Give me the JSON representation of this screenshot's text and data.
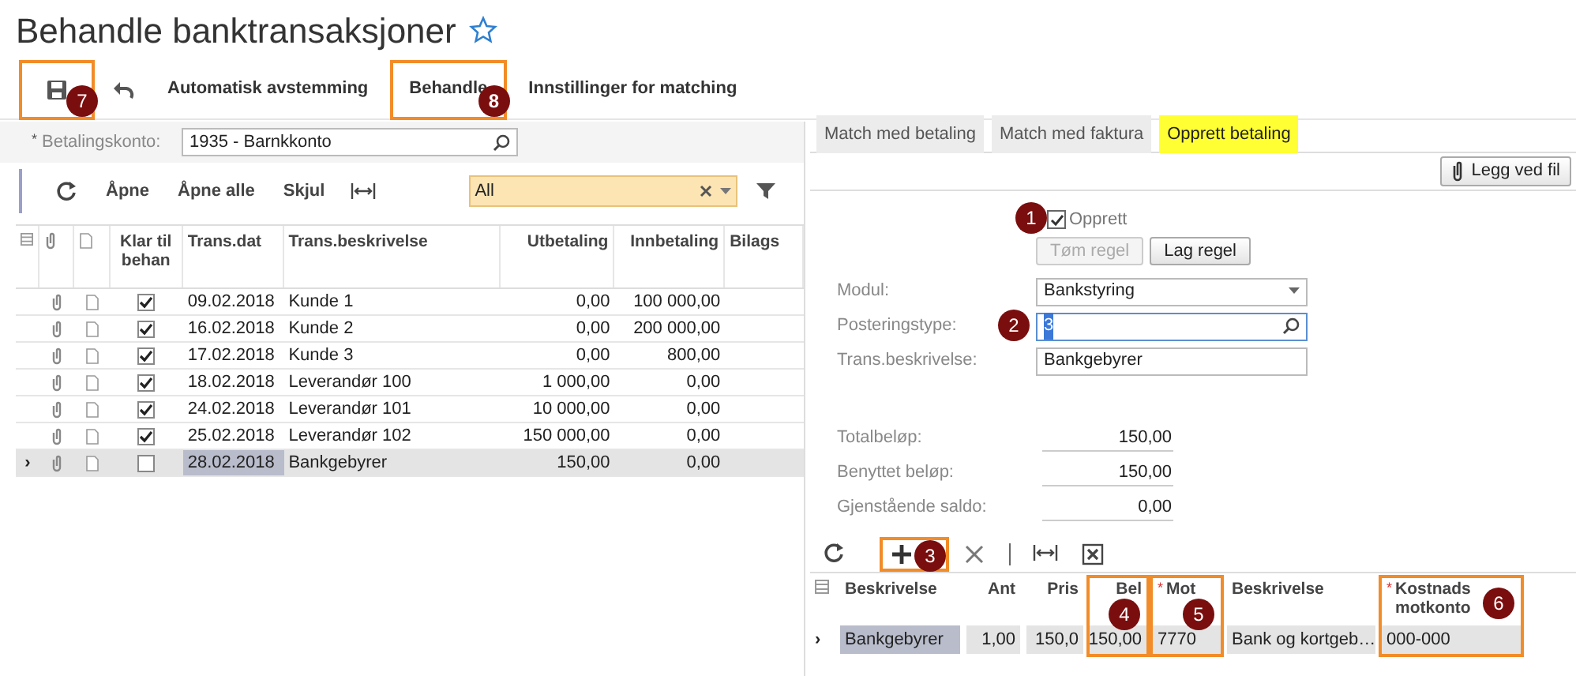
{
  "page": {
    "title": "Behandle banktransaksjoner",
    "favorite": false
  },
  "toolbar": [
    {
      "kind": "save",
      "callout": "7"
    },
    {
      "kind": "undo"
    },
    {
      "kind": "text",
      "label": "Automatisk avstemming"
    },
    {
      "kind": "text",
      "label": "Behandle",
      "callout": "8"
    },
    {
      "kind": "text",
      "label": "Innstillinger for matching"
    }
  ],
  "account": {
    "mark": "*",
    "label": "Betalingskonto:",
    "value": "1935 - Barnkkonto"
  },
  "grid_toolbar": [
    {
      "kind": "refresh"
    },
    {
      "kind": "text",
      "label": "Åpne"
    },
    {
      "kind": "text",
      "label": "Åpne alle"
    },
    {
      "kind": "text",
      "label": "Skjul"
    },
    {
      "kind": "fit"
    }
  ],
  "filter": {
    "value": "All"
  },
  "transactions": {
    "columns": [
      "Klar til behan",
      "Trans.dat",
      "Trans.beskrivelse",
      "Utbetaling",
      "Innbetaling",
      "Bilags"
    ],
    "rows": [
      {
        "checked": true,
        "selected": false,
        "date": "09.02.2018",
        "description": "Kunde 1",
        "out": "0,00",
        "in": "100 000,00"
      },
      {
        "checked": true,
        "selected": false,
        "date": "16.02.2018",
        "description": "Kunde 2",
        "out": "0,00",
        "in": "200 000,00"
      },
      {
        "checked": true,
        "selected": false,
        "date": "17.02.2018",
        "description": "Kunde 3",
        "out": "0,00",
        "in": "800,00"
      },
      {
        "checked": true,
        "selected": false,
        "date": "18.02.2018",
        "description": "Leverandør 100",
        "out": "1 000,00",
        "in": "0,00"
      },
      {
        "checked": true,
        "selected": false,
        "date": "24.02.2018",
        "description": "Leverandør 101",
        "out": "10 000,00",
        "in": "0,00"
      },
      {
        "checked": true,
        "selected": false,
        "date": "25.02.2018",
        "description": "Leverandør 102",
        "out": "150 000,00",
        "in": "0,00"
      },
      {
        "checked": false,
        "selected": true,
        "indicator": "›",
        "date": "28.02.2018",
        "description": "Bankgebyrer",
        "out": "150,00",
        "in": "0,00"
      }
    ]
  },
  "tabs": [
    {
      "label": "Match med betaling",
      "selected": false
    },
    {
      "label": "Match med faktura",
      "selected": false
    },
    {
      "label": "Opprett betaling",
      "selected": true
    }
  ],
  "attach_button": {
    "label": "Legg ved fil"
  },
  "create": {
    "label": "Opprett",
    "checked": true,
    "callout": "1"
  },
  "rule_buttons": [
    {
      "label": "Tøm regel",
      "disabled": true
    },
    {
      "label": "Lag regel",
      "disabled": false
    }
  ],
  "form": [
    {
      "kind": "dropdown",
      "label": "Modul:",
      "value": "Bankstyring"
    },
    {
      "kind": "lookup",
      "label": "Posteringstype:",
      "value": "3",
      "callout": "2"
    },
    {
      "kind": "text",
      "label": "Trans.beskrivelse:",
      "value": "Bankgebyrer"
    }
  ],
  "totals": [
    {
      "label": "Totalbeløp:",
      "value": "150,00"
    },
    {
      "label": "Benyttet beløp:",
      "value": "150,00"
    },
    {
      "label": "Gjenstående saldo:",
      "value": "0,00"
    }
  ],
  "detail_toolbar": [
    {
      "kind": "refresh"
    },
    {
      "kind": "add",
      "callout": "3"
    },
    {
      "kind": "delete"
    },
    {
      "kind": "fit"
    },
    {
      "kind": "excel"
    }
  ],
  "details": {
    "row_indicator": "›",
    "columns": [
      {
        "header": "Beskrivelse",
        "value": "Bankgebyrer"
      },
      {
        "header": "Ant",
        "value": "1,00"
      },
      {
        "header": "Pris",
        "value": "150,0"
      },
      {
        "header": "Bel",
        "value": "150,00",
        "callout": "4"
      },
      {
        "mark": "*",
        "header": "Mot",
        "value": "7770",
        "callout": "5"
      },
      {
        "header": "Beskrivelse",
        "value": "Bank og kortgeb…"
      },
      {
        "mark": "*",
        "header": "Kostnads motkonto",
        "value": "000-000",
        "callout": "6"
      }
    ]
  }
}
